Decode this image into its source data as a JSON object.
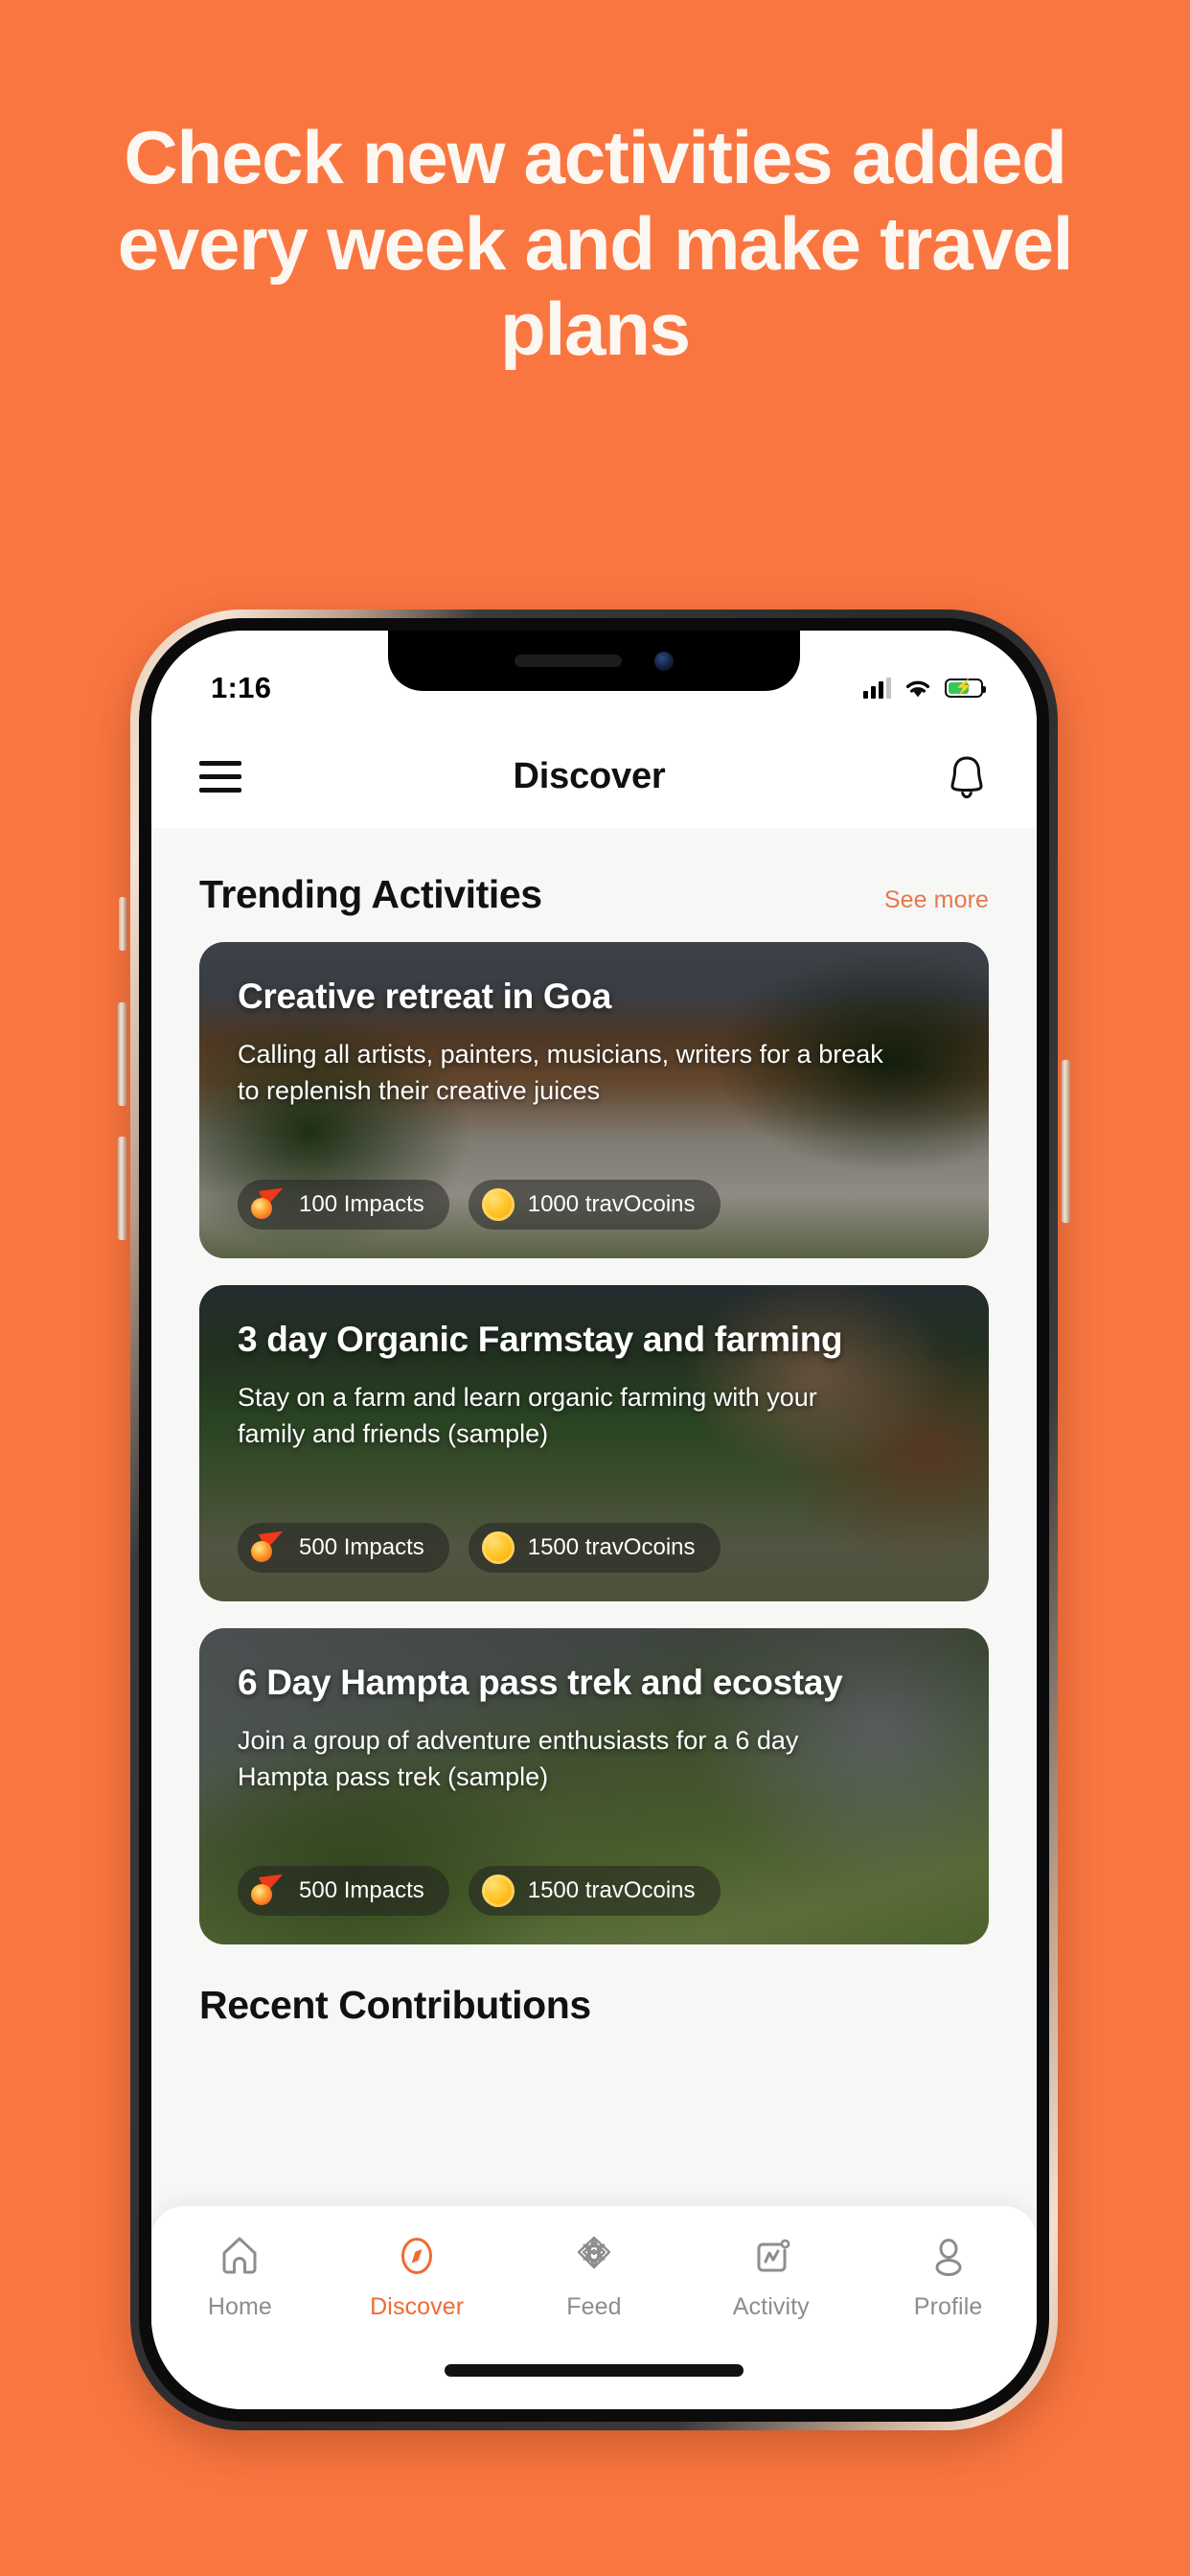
{
  "theme": {
    "background": "#FA7641",
    "accent": "#EF6B33",
    "link": "#E8774C",
    "text_dark": "#111111",
    "nav_inactive": "#8D8D8D",
    "battery_green": "#34C759"
  },
  "promo": {
    "headline": "Check new activities added every week and make travel plans"
  },
  "status_bar": {
    "time": "1:16",
    "signal_icon": "cellular-signal-icon",
    "wifi_icon": "wifi-icon",
    "battery_icon": "battery-charging-icon"
  },
  "app_bar": {
    "menu_icon": "hamburger-menu-icon",
    "title": "Discover",
    "notification_icon": "bell-icon"
  },
  "trending": {
    "title": "Trending Activities",
    "see_more": "See more",
    "cards": [
      {
        "title": "Creative retreat in Goa",
        "description": "Calling all artists, painters, musicians, writers for a break to replenish their creative juices",
        "impacts": "100 Impacts",
        "coins": "1000 travOcoins",
        "impacts_icon": "comet-flame-icon",
        "coins_icon": "gold-coin-icon"
      },
      {
        "title": "3 day Organic Farmstay and farming",
        "description": "Stay on a farm and learn organic farming with your family and friends (sample)",
        "impacts": "500 Impacts",
        "coins": "1500 travOcoins",
        "impacts_icon": "comet-flame-icon",
        "coins_icon": "gold-coin-icon"
      },
      {
        "title": "6 Day Hampta pass trek and ecostay",
        "description": "Join a group of adventure enthusiasts for a 6 day Hampta pass trek (sample)",
        "impacts": "500 Impacts",
        "coins": "1500 travOcoins",
        "impacts_icon": "comet-flame-icon",
        "coins_icon": "gold-coin-icon"
      }
    ]
  },
  "recent": {
    "title": "Recent Contributions"
  },
  "bottom_nav": {
    "items": [
      {
        "label": "Home",
        "icon": "home-icon",
        "active": false
      },
      {
        "label": "Discover",
        "icon": "compass-icon",
        "active": true
      },
      {
        "label": "Feed",
        "icon": "knot-icon",
        "active": false
      },
      {
        "label": "Activity",
        "icon": "activity-icon",
        "active": false
      },
      {
        "label": "Profile",
        "icon": "person-icon",
        "active": false
      }
    ]
  }
}
